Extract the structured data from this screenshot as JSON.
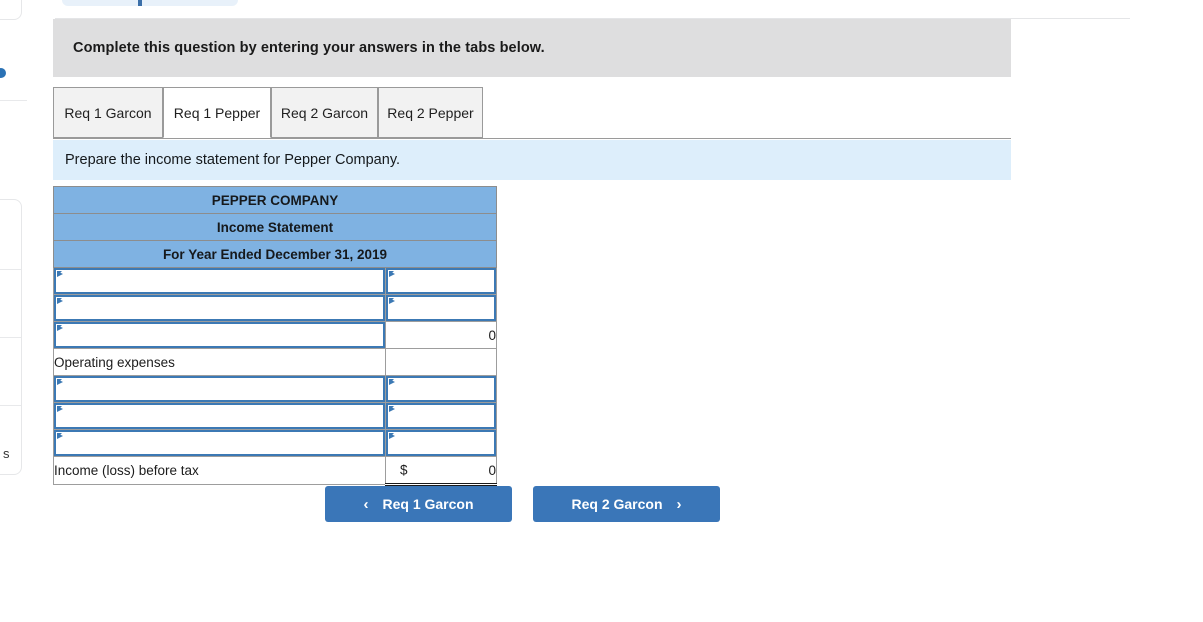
{
  "instruction": {
    "text": "Complete this question by entering your answers in the tabs below."
  },
  "tabs": [
    {
      "label": "Req 1 Garcon",
      "active": false
    },
    {
      "label": "Req 1 Pepper",
      "active": true
    },
    {
      "label": "Req 2 Garcon",
      "active": false
    },
    {
      "label": "Req 2 Pepper",
      "active": false
    }
  ],
  "requirement": {
    "text": "Prepare the income statement for Pepper Company."
  },
  "statement": {
    "title_lines": [
      "PEPPER COMPANY",
      "Income Statement",
      "For Year Ended December 31, 2019"
    ],
    "rows": [
      {
        "label": "",
        "label_editable": true,
        "amount": "",
        "amount_editable": true,
        "amount_rule": "none",
        "dollar": false
      },
      {
        "label": "",
        "label_editable": true,
        "amount": "",
        "amount_editable": true,
        "amount_rule": "none",
        "dollar": false
      },
      {
        "label": "",
        "label_editable": true,
        "amount": "0",
        "amount_editable": false,
        "amount_rule": "subtotal",
        "dollar": false
      },
      {
        "label": "Operating expenses",
        "label_editable": false,
        "amount": "",
        "amount_editable": false,
        "amount_rule": "none",
        "dollar": false
      },
      {
        "label": "",
        "label_editable": true,
        "amount": "",
        "amount_editable": true,
        "amount_rule": "none",
        "dollar": false
      },
      {
        "label": "",
        "label_editable": true,
        "amount": "",
        "amount_editable": true,
        "amount_rule": "none",
        "dollar": false
      },
      {
        "label": "",
        "label_editable": true,
        "amount": "",
        "amount_editable": true,
        "amount_rule": "none",
        "dollar": false
      },
      {
        "label": "Income (loss) before tax",
        "label_editable": false,
        "amount": "0",
        "amount_editable": false,
        "amount_rule": "total",
        "dollar": true
      }
    ],
    "currency_symbol": "$"
  },
  "navigation": {
    "prev": {
      "label": "Req 1 Garcon",
      "chevron": "‹"
    },
    "next": {
      "label": "Req 2 Garcon",
      "chevron": "›"
    }
  },
  "fragments": {
    "left_list_text": "s"
  },
  "colors": {
    "header_blue": "#7fb2e2",
    "banner_blue": "#ddeefb",
    "instruction_grey": "#dededf",
    "button_blue": "#3a76b8",
    "field_border": "#3c79b4"
  }
}
